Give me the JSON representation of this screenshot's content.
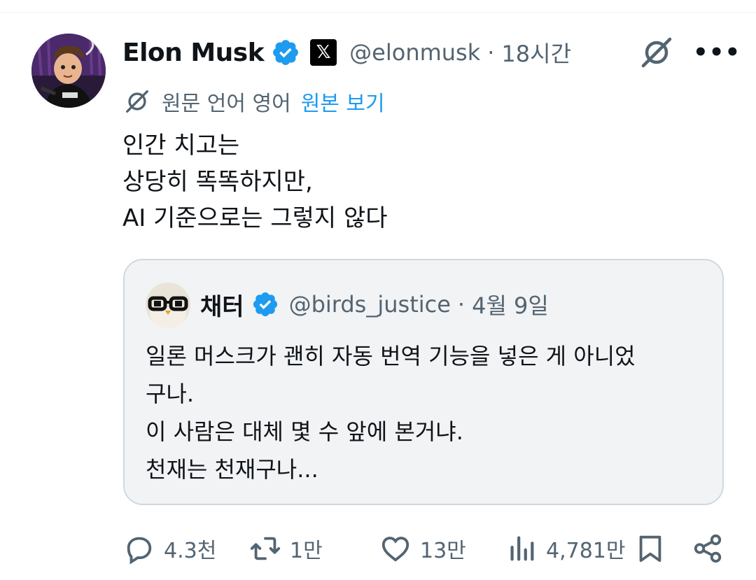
{
  "tweet": {
    "author": {
      "name": "Elon Musk",
      "handle": "@elonmusk",
      "verified": true,
      "affiliate_badge": "𝕏"
    },
    "separator": "·",
    "time": "18시간",
    "translation": {
      "label": "원문 언어 영어",
      "link": "원본 보기"
    },
    "lines": [
      "인간 치고는",
      "상당히 똑똑하지만,",
      "AI 기준으로는 그렇지 않다"
    ]
  },
  "quote": {
    "author": {
      "name": "채터",
      "handle": "@birds_justice",
      "verified": true
    },
    "separator": "·",
    "date": "4월 9일",
    "lines": [
      "일론 머스크가 괜히 자동 번역 기능을 넣은 게 아니었",
      "구나.",
      "이 사람은 대체 몇 수 앞에 본거냐.",
      "천재는 천재구나..."
    ]
  },
  "actions": {
    "replies": "4.3천",
    "reposts": "1만",
    "likes": "13만",
    "views": "4,781만"
  },
  "icons": {
    "grok": "grok-icon",
    "more": "more-icon",
    "reply": "reply-icon",
    "repost": "repost-icon",
    "like": "heart-icon",
    "views": "views-icon",
    "bookmark": "bookmark-icon",
    "share": "share-icon"
  },
  "colors": {
    "accent": "#1d9bf0",
    "secondary_text": "#536471",
    "quote_bg": "#f2f3f5",
    "text": "#0f1419"
  }
}
